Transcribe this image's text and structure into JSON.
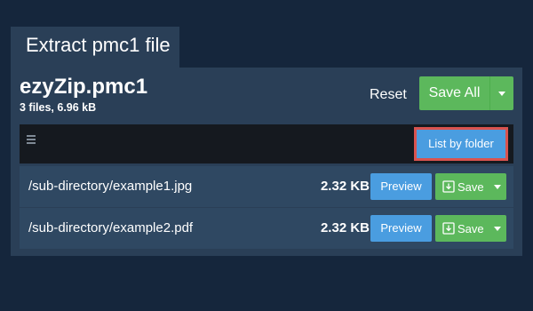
{
  "tab": {
    "title": "Extract pmc1 file"
  },
  "archive": {
    "name": "ezyZip.pmc1",
    "meta": "3 files, 6.96 kB"
  },
  "actions": {
    "reset_label": "Reset",
    "save_all_label": "Save All"
  },
  "toolbar": {
    "list_by_folder_label": "List by folder"
  },
  "files": [
    {
      "path": "/sub-directory/example1.jpg",
      "size": "2.32 KB",
      "preview_label": "Preview",
      "save_label": "Save"
    },
    {
      "path": "/sub-directory/example2.pdf",
      "size": "2.32 KB",
      "preview_label": "Preview",
      "save_label": "Save"
    }
  ],
  "colors": {
    "background": "#15263c",
    "panel": "#2a3f57",
    "row": "#2f4862",
    "primary_blue": "#4a9de0",
    "success_green": "#5cb85c",
    "highlight_red": "#d9534f"
  },
  "icons": {
    "menu": "hamburger-icon",
    "save": "download-icon",
    "caret": "caret-down-icon"
  }
}
